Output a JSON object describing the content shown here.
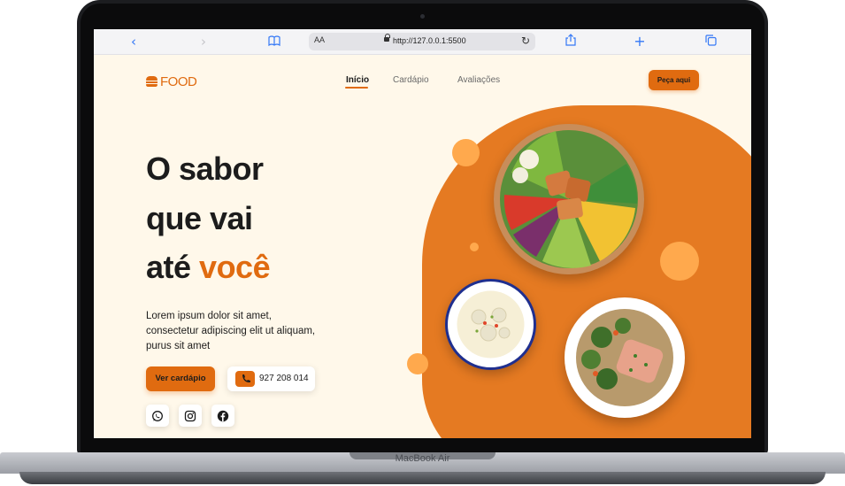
{
  "device": {
    "label": "MacBook Air"
  },
  "browser": {
    "text_size_label": "AA",
    "url": "http://127.0.0.1:5500",
    "icons": [
      "back-icon",
      "forward-icon",
      "bookmarks-icon",
      "reload-icon",
      "share-icon",
      "new-tab-icon",
      "tabs-icon"
    ]
  },
  "site": {
    "logo_text": "FOOD",
    "nav": [
      {
        "label": "Início",
        "active": true
      },
      {
        "label": "Cardápio",
        "active": false
      },
      {
        "label": "Avaliações",
        "active": false
      }
    ],
    "order_button": "Peça aqui",
    "hero": {
      "line1": "O sabor",
      "line2": "que vai",
      "line3_prefix": "até",
      "line3_accent": "você",
      "description": "Lorem ipsum dolor sit amet, consectetur adipiscing elit ut aliquam, purus sit amet",
      "menu_button": "Ver cardápio",
      "phone": "927 208 014"
    },
    "social": [
      "whatsapp-icon",
      "instagram-icon",
      "facebook-icon"
    ],
    "colors": {
      "accent": "#e06b10",
      "background": "#fff8ea",
      "shape": "#e57a22",
      "bubble": "#ffa94d"
    }
  }
}
